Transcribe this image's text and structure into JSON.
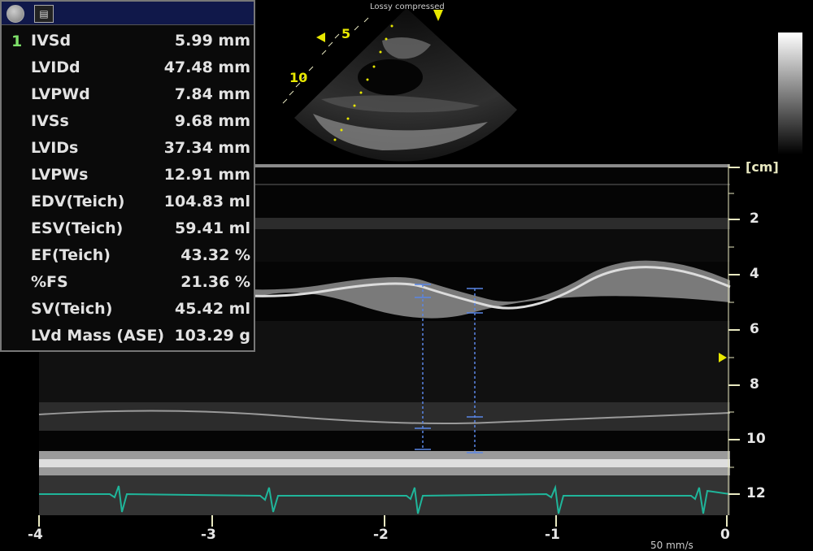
{
  "header": {
    "compression_label": "Lossy compressed"
  },
  "panel": {
    "index": "1",
    "measurements": [
      {
        "name": "IVSd",
        "value": "5.99 mm"
      },
      {
        "name": "LVIDd",
        "value": "47.48 mm"
      },
      {
        "name": "LVPWd",
        "value": "7.84 mm"
      },
      {
        "name": "IVSs",
        "value": "9.68 mm"
      },
      {
        "name": "LVIDs",
        "value": "37.34 mm"
      },
      {
        "name": "LVPWs",
        "value": "12.91 mm"
      },
      {
        "name": "EDV(Teich)",
        "value": "104.83 ml"
      },
      {
        "name": "ESV(Teich)",
        "value": "59.41 ml"
      },
      {
        "name": "EF(Teich)",
        "value": "43.32 %"
      },
      {
        "name": "%FS",
        "value": "21.36 %"
      },
      {
        "name": "SV(Teich)",
        "value": "45.42 ml"
      },
      {
        "name": "LVd Mass (ASE)",
        "value": "103.29 g"
      }
    ]
  },
  "sector": {
    "depth_labels": [
      "5",
      "10"
    ]
  },
  "mmode": {
    "depth_unit": "[cm]",
    "depth_labels": [
      "2",
      "4",
      "6",
      "8",
      "10",
      "12"
    ],
    "time_labels": [
      "-4",
      "-3",
      "-2",
      "-1",
      "0"
    ],
    "sweep_speed": "50 mm/s"
  },
  "colors": {
    "ecg": "#1fb59a",
    "caliper": "#5a86e6",
    "marker": "#e8e800",
    "panel_title": "#10184a"
  },
  "icons": [
    "stop-icon",
    "calculator-icon",
    "focus-marker-icon",
    "sector-marker-icon"
  ]
}
